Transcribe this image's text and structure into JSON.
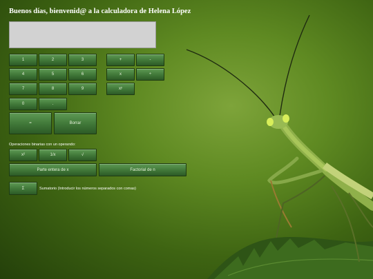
{
  "title": "Buenos días, bienvenid@ a la calculadora de Helena López",
  "display": {
    "value": ""
  },
  "keypad": {
    "k1": "1",
    "k2": "2",
    "k3": "3",
    "k4": "4",
    "k5": "5",
    "k6": "6",
    "k7": "7",
    "k8": "8",
    "k9": "9",
    "k0": "0",
    "dot": ".",
    "plus": "+",
    "minus": "-",
    "times": "x",
    "divide": "÷",
    "power": "xʸ",
    "equals": "=",
    "clear": "Borrar"
  },
  "unary": {
    "heading": "Operaciones binarias con un operando:",
    "square": "x²",
    "reciprocal": "1/x",
    "sqrt": "√",
    "integer_part": "Parte entera de x",
    "factorial": "Factorial de n"
  },
  "summation": {
    "button": "Σ",
    "hint": "Sumatorio (Introducir los números separados con comas)"
  }
}
